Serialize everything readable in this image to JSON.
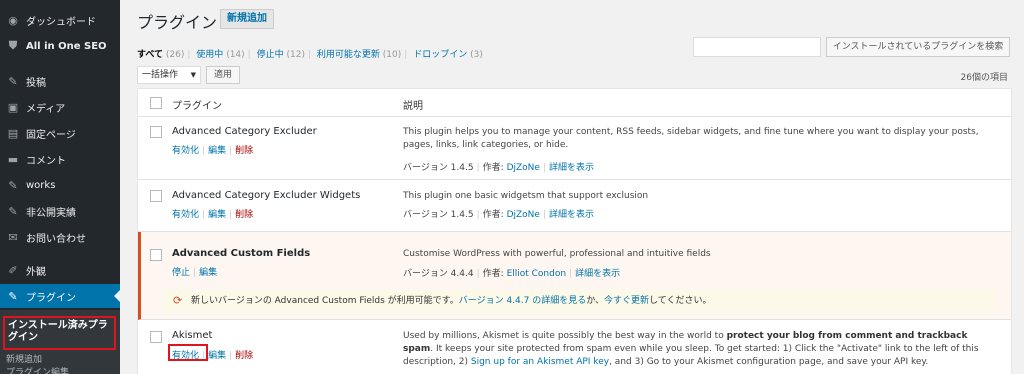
{
  "sidebar": {
    "items": [
      {
        "label": "ダッシュボード",
        "icon": "dashboard-icon",
        "glyph": "◉"
      },
      {
        "label": "All in One SEO",
        "icon": "shield-icon",
        "glyph": "⛊"
      },
      {
        "label": "投稿",
        "icon": "pin-icon",
        "glyph": "✎"
      },
      {
        "label": "メディア",
        "icon": "media-icon",
        "glyph": "▣"
      },
      {
        "label": "固定ページ",
        "icon": "page-icon",
        "glyph": "▤"
      },
      {
        "label": "コメント",
        "icon": "comment-icon",
        "glyph": "▬"
      },
      {
        "label": "works",
        "icon": "pin-icon",
        "glyph": "✎"
      },
      {
        "label": "非公開実績",
        "icon": "pin-icon",
        "glyph": "✎"
      },
      {
        "label": "お問い合わせ",
        "icon": "mail-icon",
        "glyph": "✉"
      },
      {
        "label": "外観",
        "icon": "brush-icon",
        "glyph": "✐"
      },
      {
        "label": "プラグイン",
        "icon": "plugin-icon",
        "glyph": "✎"
      }
    ],
    "submenu": {
      "current": "インストール済みプラグイン",
      "add_new": "新規追加",
      "partial": "プラグイン編集"
    }
  },
  "header": {
    "title": "プラグイン",
    "add_new": "新規追加"
  },
  "filters": {
    "all_label": "すべて",
    "all_count": "(26)",
    "active_label": "使用中",
    "active_count": "(14)",
    "inactive_label": "停止中",
    "inactive_count": "(12)",
    "update_label": "利用可能な更新",
    "update_count": "(10)",
    "dropin_label": "ドロップイン",
    "dropin_count": "(3)"
  },
  "search": {
    "placeholder": "",
    "button": "インストールされているプラグインを検索"
  },
  "bulk": {
    "selected": "一括操作",
    "apply": "適用",
    "item_count": "26個の項目"
  },
  "table": {
    "col_plugin": "プラグイン",
    "col_desc": "説明"
  },
  "plugins": [
    {
      "name": "Advanced Category Excluder",
      "actions": [
        "有効化",
        "編集",
        "削除"
      ],
      "description": "This plugin helps you to manage your content, RSS feeds, sidebar widgets, and fine tune where you want to display your posts, pages, links, link categories, or hide.",
      "version": "バージョン 1.4.5",
      "author_prefix": "作者:",
      "author": "DjZoNe",
      "details": "詳細を表示"
    },
    {
      "name": "Advanced Category Excluder Widgets",
      "actions": [
        "有効化",
        "編集",
        "削除"
      ],
      "description": "This plugin one basic widgetsm that support exclusion",
      "version": "バージョン 1.4.5",
      "author_prefix": "作者:",
      "author": "DjZoNe",
      "details": "詳細を表示"
    },
    {
      "name": "Advanced Custom Fields",
      "actions": [
        "停止",
        "編集"
      ],
      "description": "Customise WordPress with powerful, professional and intuitive fields",
      "version": "バージョン 4.4.4",
      "author_prefix": "作者:",
      "author": "Elliot Condon",
      "details": "詳細を表示",
      "update": {
        "pre": "新しいバージョンの Advanced Custom Fields が利用可能です。",
        "link": "バージョン 4.4.7 の詳細を見る",
        "mid": "か、",
        "link2": "今すぐ更新",
        "post": "してください。"
      }
    },
    {
      "name": "Akismet",
      "actions": [
        "有効化",
        "編集",
        "削除"
      ],
      "description_pre": "Used by millions, Akismet is quite possibly the best way in the world to ",
      "description_strong": "protect your blog from comment and trackback spam",
      "description_mid": ". It keeps your site protected from spam even while you sleep. To get started: 1) Click the \"Activate\" link to the left of this description, 2) ",
      "description_link": "Sign up for an Akismet API key",
      "description_post": ", and 3) Go to your Akismet configuration page, and save your API key."
    }
  ],
  "colors": {
    "sidebar_bg": "#23282d",
    "accent": "#0073aa",
    "delete": "#aa0000",
    "highlight": "#e0141c"
  }
}
